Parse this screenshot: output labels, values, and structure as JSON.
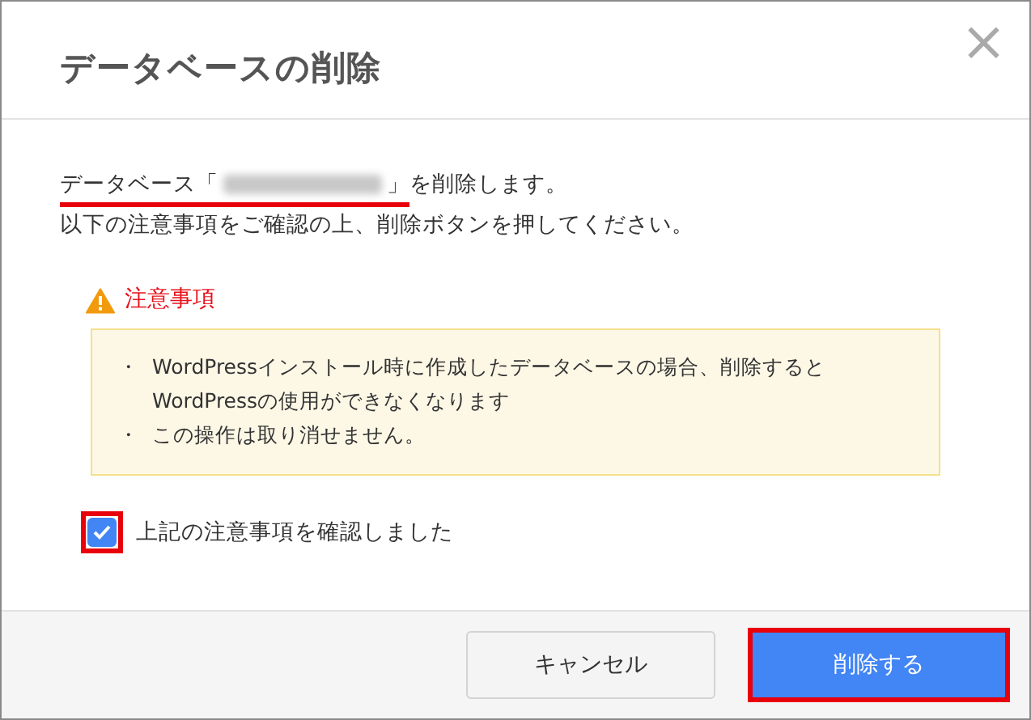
{
  "dialog": {
    "title": "データベースの削除",
    "close": "×"
  },
  "message": {
    "prefix": "データベース「",
    "redacted": true,
    "suffix": "」",
    "rest": "を削除します。",
    "highlighted": true
  },
  "instruction": "以下の注意事項をご確認の上、削除ボタンを押してください。",
  "warning": {
    "heading": "注意事項",
    "items": [
      {
        "bullet": "・",
        "lines": [
          "WordPressインストール時に作成したデータベースの場合、削除すると",
          "WordPressの使用ができなくなります"
        ]
      },
      {
        "bullet": "・",
        "lines": [
          "この操作は取り消せません。"
        ]
      }
    ]
  },
  "confirm": {
    "label": "上記の注意事項を確認しました",
    "checked": true,
    "highlighted": true
  },
  "buttons": [
    {
      "label": "キャンセル",
      "kind": "secondary",
      "highlighted": false
    },
    {
      "label": "削除する",
      "kind": "primary",
      "highlighted": true
    }
  ]
}
